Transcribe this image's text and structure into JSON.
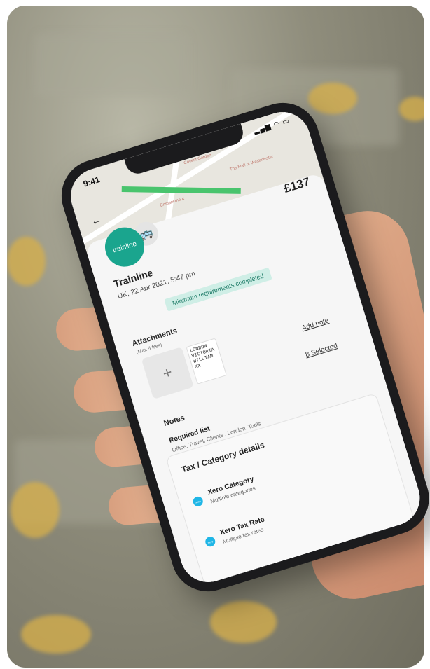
{
  "status_bar": {
    "time": "9:41",
    "icons": "▂▄▆ ◠ ▭"
  },
  "map": {
    "labels": [
      "Covent Garden",
      "Embankment",
      "The Mall of Westminster"
    ]
  },
  "navigation": {
    "back_icon": "←"
  },
  "merchant": {
    "logo_text": "trainline",
    "transport_icon": "🚌",
    "name": "Trainline",
    "date": "UK, 22 Apr 2021, 5:47 pm",
    "amount": "£137",
    "status": "Minimum requirements completed"
  },
  "attachments": {
    "title": "Attachments",
    "limit": "(Max 5 files)",
    "add_icon": "+",
    "ticket_text": "LONDON VICTORIA WILLIAM XX"
  },
  "actions": {
    "add_note": "Add note",
    "selected": "8 Selected"
  },
  "notes": {
    "title": "Notes",
    "required_title": "Required list",
    "required_values": "Office, Travel, Clients , London, Tools"
  },
  "tax": {
    "title": "Tax / Category details",
    "items": [
      {
        "icon": "xero",
        "label": "Xero Category",
        "sub": "Multiple categories"
      },
      {
        "icon": "xero",
        "label": "Xero Tax Rate",
        "sub": "Multiple tax rates"
      }
    ]
  },
  "colors": {
    "brand": "#1aa58e",
    "badge_bg": "#cfeee6",
    "xero": "#20b6e6"
  }
}
